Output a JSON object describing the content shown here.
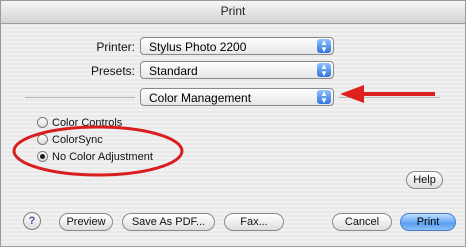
{
  "window": {
    "title": "Print"
  },
  "printer": {
    "label": "Printer:",
    "value": "Stylus Photo 2200"
  },
  "presets": {
    "label": "Presets:",
    "value": "Standard"
  },
  "panel": {
    "value": "Color Management"
  },
  "color_options": [
    {
      "label": "Color Controls",
      "selected": false
    },
    {
      "label": "ColorSync",
      "selected": false
    },
    {
      "label": "No Color Adjustment",
      "selected": true
    }
  ],
  "buttons": {
    "help_small": "Help",
    "help_icon": "?",
    "preview": "Preview",
    "save_pdf": "Save As PDF...",
    "fax": "Fax...",
    "cancel": "Cancel",
    "print": "Print"
  },
  "annotations": {
    "arrow_color": "#e0201e",
    "ellipse_color": "#d81e1e"
  },
  "icons": {
    "popup": "updown-arrows-icon",
    "help": "question-mark-icon"
  }
}
